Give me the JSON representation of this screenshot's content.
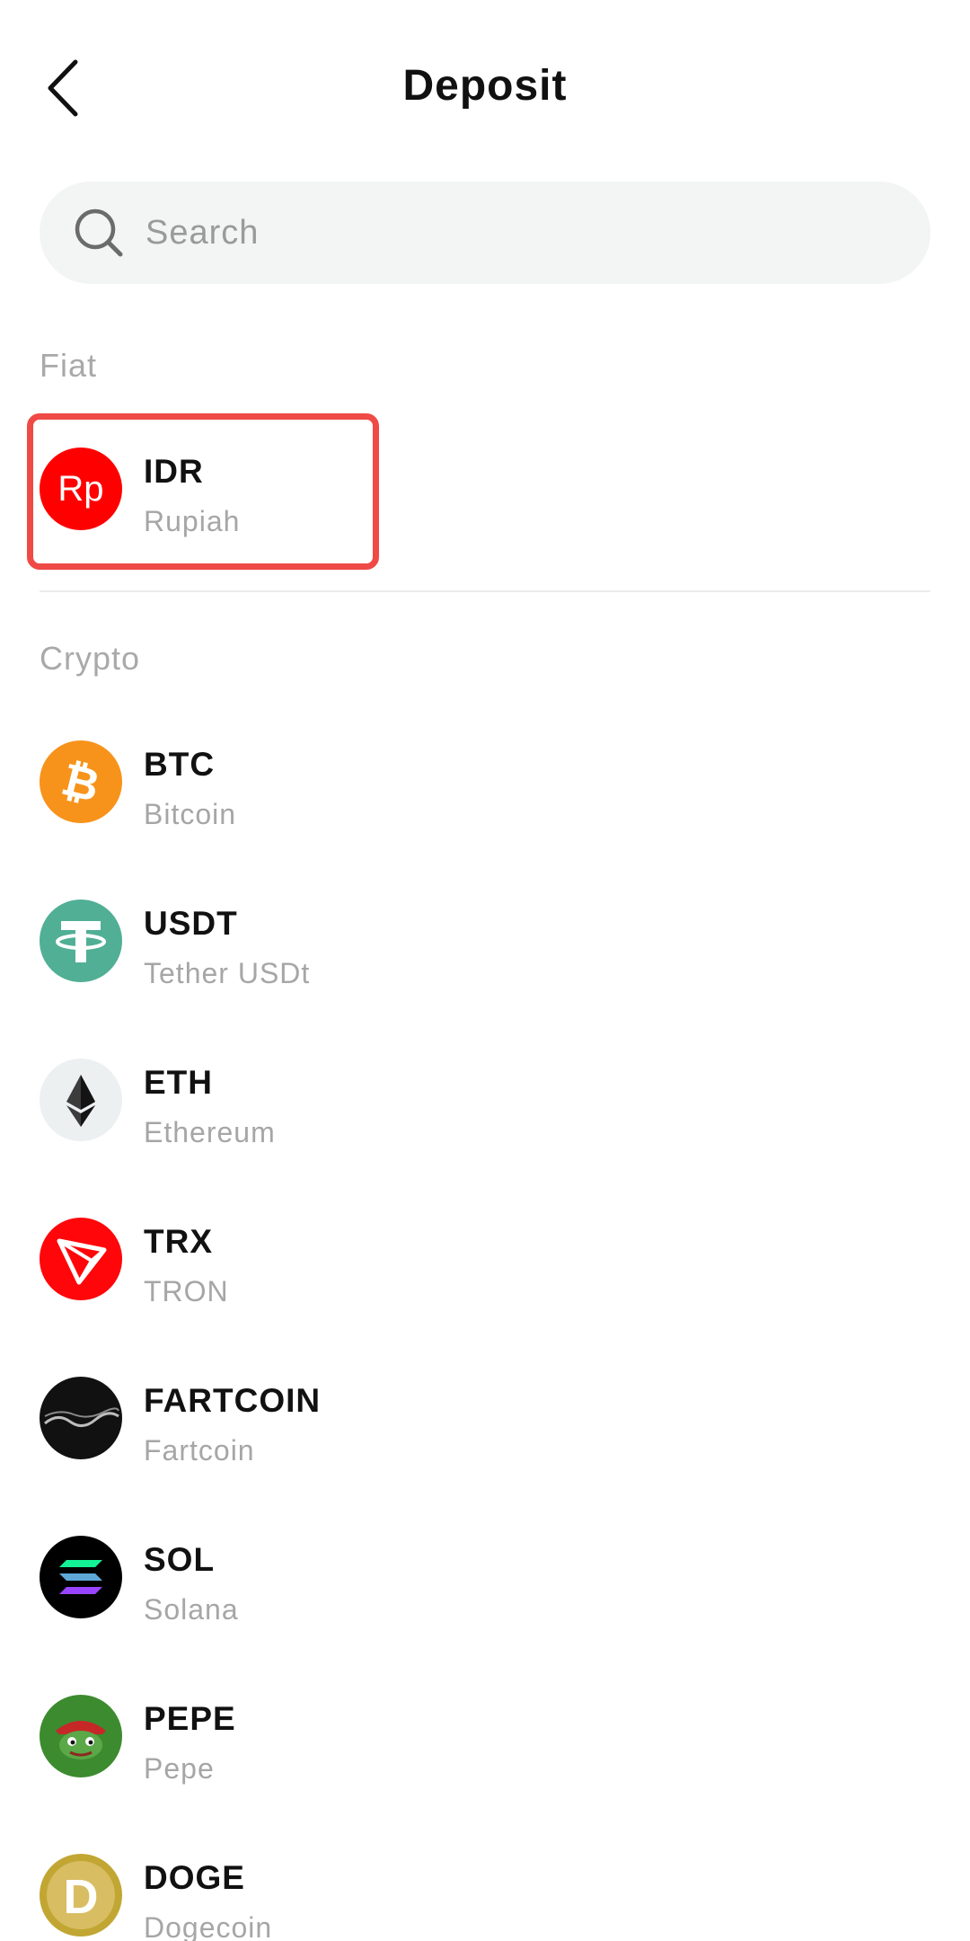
{
  "header": {
    "title": "Deposit",
    "back_icon": "chevron-left-icon"
  },
  "search": {
    "placeholder": "Search",
    "value": "",
    "icon": "search-icon"
  },
  "sections": {
    "fiat": {
      "title": "Fiat",
      "items": [
        {
          "symbol": "IDR",
          "name": "Rupiah",
          "icon": "rupiah-icon",
          "color": "#ff0000",
          "highlighted": true
        }
      ]
    },
    "crypto": {
      "title": "Crypto",
      "items": [
        {
          "symbol": "BTC",
          "name": "Bitcoin",
          "icon": "bitcoin-icon",
          "color": "#f7931a"
        },
        {
          "symbol": "USDT",
          "name": "Tether USDt",
          "icon": "tether-icon",
          "color": "#50af95"
        },
        {
          "symbol": "ETH",
          "name": "Ethereum",
          "icon": "ethereum-icon",
          "color": "#ecf0f1"
        },
        {
          "symbol": "TRX",
          "name": "TRON",
          "icon": "tron-icon",
          "color": "#ff060a"
        },
        {
          "symbol": "FARTCOIN",
          "name": "Fartcoin",
          "icon": "fartcoin-icon",
          "color": "#111111"
        },
        {
          "symbol": "SOL",
          "name": "Solana",
          "icon": "solana-icon",
          "color": "#000000"
        },
        {
          "symbol": "PEPE",
          "name": "Pepe",
          "icon": "pepe-icon",
          "color": "#3d8b2f"
        },
        {
          "symbol": "DOGE",
          "name": "Dogecoin",
          "icon": "dogecoin-icon",
          "color": "#c2a633"
        }
      ]
    }
  },
  "colors": {
    "highlight_border": "#ef4a45",
    "secondary_text": "#a6a6a6",
    "search_bg": "#f3f4f4"
  }
}
